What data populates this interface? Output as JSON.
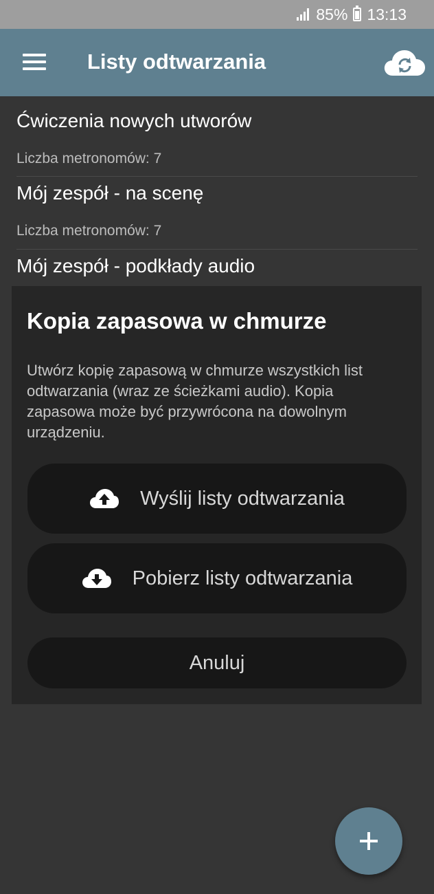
{
  "status_bar": {
    "battery_percent": "85%",
    "time": "13:13"
  },
  "app_bar": {
    "title": "Listy odtwarzania",
    "menu_icon": "hamburger-menu-icon",
    "sync_icon": "cloud-sync-icon"
  },
  "playlists": [
    {
      "title": "Ćwiczenia nowych utworów",
      "subtitle": "Liczba metronomów: 7"
    },
    {
      "title": "Mój zespół - na scenę",
      "subtitle": "Liczba metronomów: 7"
    },
    {
      "title": "Mój zespół - podkłady audio",
      "subtitle": ""
    }
  ],
  "dialog": {
    "title": "Kopia zapasowa w chmurze",
    "body": "Utwórz kopię zapasową w chmurze wszystkich list odtwarzania (wraz ze ścieżkami audio). Kopia zapasowa może być przywrócona na dowolnym urządzeniu.",
    "upload_label": "Wyślij listy odtwarzania",
    "upload_icon": "cloud-upload-icon",
    "download_label": "Pobierz listy odtwarzania",
    "download_icon": "cloud-download-icon",
    "cancel_label": "Anuluj"
  },
  "fab": {
    "icon": "plus-icon"
  },
  "colors": {
    "app_bar": "#5f8090",
    "background": "#353535",
    "dialog": "#262626",
    "button": "#171717"
  }
}
